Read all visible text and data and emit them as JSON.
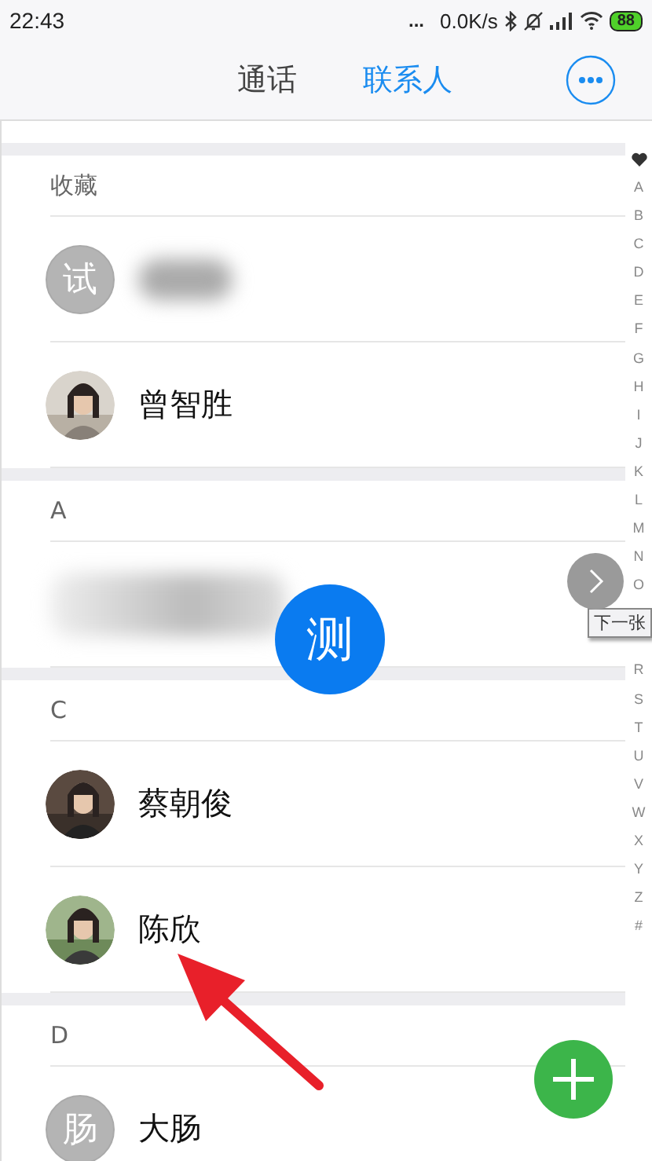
{
  "status_bar": {
    "time": "22:43",
    "dots": "...",
    "speed": "0.0K/s",
    "battery": "88"
  },
  "tabs": [
    {
      "label": "通话",
      "selected": false
    },
    {
      "label": "联系人",
      "selected": true
    }
  ],
  "sections": [
    {
      "header": "收藏",
      "contacts": [
        {
          "avatar": {
            "kind": "letter",
            "text": "试"
          },
          "name_blurred": true
        },
        {
          "name": "曾智胜",
          "name_blurred": false
        }
      ]
    },
    {
      "header": "A",
      "contacts": [
        {
          "avatar": {
            "kind": "hidden"
          },
          "name_blurred": true
        }
      ]
    },
    {
      "header": "C",
      "contacts": [
        {
          "name": "蔡朝俊",
          "name_blurred": false
        },
        {
          "name": "陈欣",
          "name_blurred": false
        }
      ]
    },
    {
      "header": "D",
      "contacts": [
        {
          "avatar": {
            "kind": "letter",
            "text": "肠"
          },
          "name": "大肠",
          "name_blurred": false
        }
      ]
    }
  ],
  "index_top": [
    "A",
    "B",
    "C",
    "D",
    "E",
    "F",
    "G",
    "H",
    "I",
    "J",
    "K",
    "L",
    "M",
    "N",
    "O"
  ],
  "index_bottom": [
    "R",
    "S",
    "T",
    "U",
    "V",
    "W",
    "X",
    "Y",
    "Z",
    "#"
  ],
  "drag_bubble": "测",
  "next_tooltip": "下一张"
}
